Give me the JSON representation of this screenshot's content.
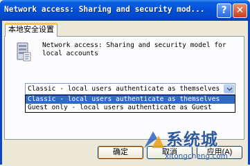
{
  "window": {
    "title": "Network access: Sharing and security mod...",
    "help_label": "?",
    "close_label": "✕"
  },
  "tabs": [
    {
      "label": "本地安全设置",
      "active": true
    }
  ],
  "policy": {
    "icon": "policy-server-icon",
    "description": "Network access: Sharing and security model for\nlocal accounts"
  },
  "combo": {
    "selected": "Classic - local users authenticate as themselves",
    "options": [
      "Classic - local users authenticate as themselves",
      "Guest only - local users authenticate as Guest"
    ],
    "highlighted_index": 0
  },
  "buttons": {
    "ok": "确定",
    "cancel": "取消",
    "apply": "应用(A)"
  },
  "watermark": {
    "text": "系统城",
    "url": "xitongcheng.com"
  },
  "colors": {
    "titlebar": "#0050d8",
    "selection": "#316ac5",
    "tab_accent": "#ffc83c"
  }
}
